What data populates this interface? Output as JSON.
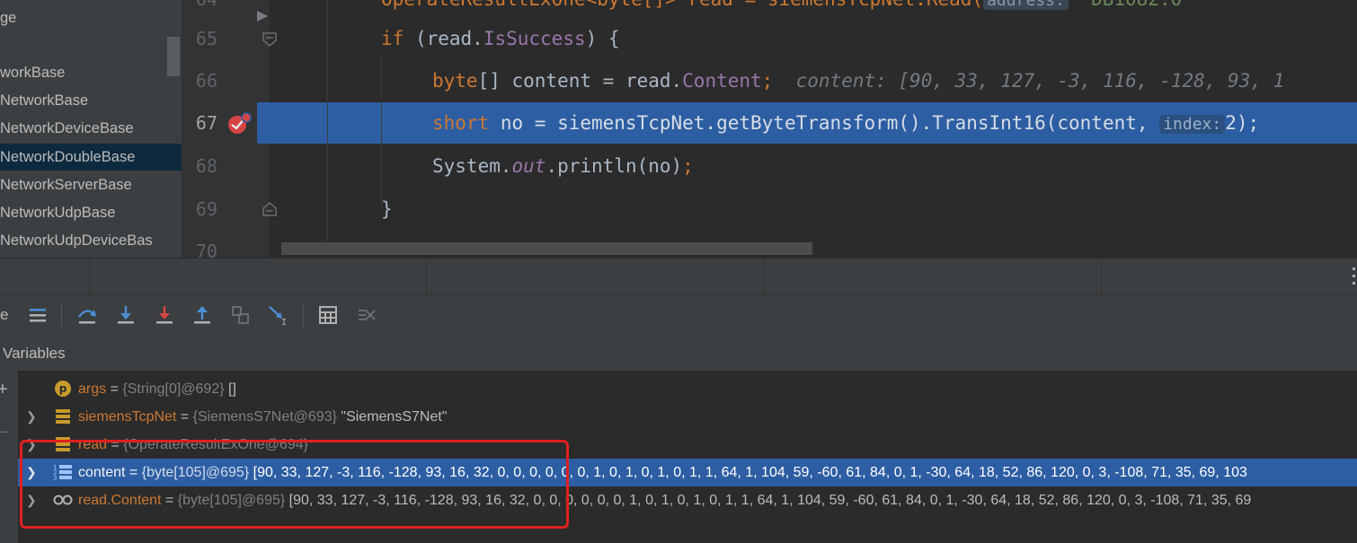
{
  "project_tree": {
    "items": [
      {
        "label": "ge"
      },
      {
        "label": "workBase"
      },
      {
        "label": "NetworkBase"
      },
      {
        "label": "NetworkDeviceBase"
      },
      {
        "label": "NetworkDoubleBase",
        "selected": true
      },
      {
        "label": "NetworkServerBase"
      },
      {
        "label": "NetworkUdpBase"
      },
      {
        "label": "NetworkUdpDeviceBas"
      }
    ]
  },
  "editor": {
    "line_numbers": [
      "64",
      "65",
      "66",
      "67",
      "68",
      "69",
      "70"
    ],
    "lines": {
      "l64": {
        "keyword": "OperateResultExOne<byte[]> read = siemensTcpNet.Read(",
        "hint": "address:",
        "rest": " \"DB1082.0\""
      },
      "l65": {
        "kw": "if",
        "rest_a": " (read.",
        "method": "IsSuccess",
        "rest_b": ") {"
      },
      "l66": {
        "type": "byte",
        "rest_a": "[] content = read.",
        "field": "Content",
        "semi": ";",
        "hint": "content: [90, 33, 127, -3, 116, -128, 93, 1"
      },
      "l67": {
        "type": "short",
        "rest_a": " no = siemensTcpNet.getByteTransform().TransInt16(content,",
        "param_hint": "index:",
        "rest_b": "2);"
      },
      "l68": {
        "rest_a": "System.",
        "field": "out",
        "rest_b": ".println(no)",
        "semi": ";"
      },
      "l69": {
        "rest": "}"
      }
    }
  },
  "debug": {
    "variables_label": "Variables",
    "toolbar_left_label": "e",
    "variables": [
      {
        "name": "args",
        "eq": " = ",
        "type": "{String[0]@692}",
        "value": " []",
        "icon": "parameter-icon"
      },
      {
        "name": "siemensTcpNet",
        "eq": " = ",
        "type": "{SiemensS7Net@693}",
        "value": " \"SiemensS7Net\"",
        "icon": "field-icon"
      },
      {
        "name": "read",
        "eq": " = ",
        "type": "{OperateResultExOne@694}",
        "value": "",
        "icon": "field-icon"
      },
      {
        "name": "content",
        "eq": " = ",
        "type": "{byte[105]@695}",
        "value": " [90, 33, 127, -3, 116, -128, 93, 16, 32, 0, 0, 0, 0, 0, 0, 1, 0, 1, 0, 1, 0, 1, 1, 64, 1, 104, 59, -60, 61, 84, 0, 1, -30, 64, 18, 52, 86, 120, 0, 3, -108, 71, 35, 69, 103",
        "icon": "array-icon",
        "selected": true
      },
      {
        "name": "read.Content",
        "eq": " = ",
        "type": "{byte[105]@695}",
        "value": " [90, 33, 127, -3, 116, -128, 93, 16, 32, 0, 0, 0, 0, 0, 0, 1, 0, 1, 0, 1, 0, 1, 1, 64, 1, 104, 59, -60, 61, 84, 0, 1, -30, 64, 18, 52, 86, 120, 0, 3, -108, 71, 35, 69",
        "icon": "watch-icon"
      }
    ]
  },
  "colors": {
    "keyword": "#cc7832",
    "member": "#9876aa",
    "selection": "#2d5ea3",
    "annotation_box": "#e02020"
  }
}
